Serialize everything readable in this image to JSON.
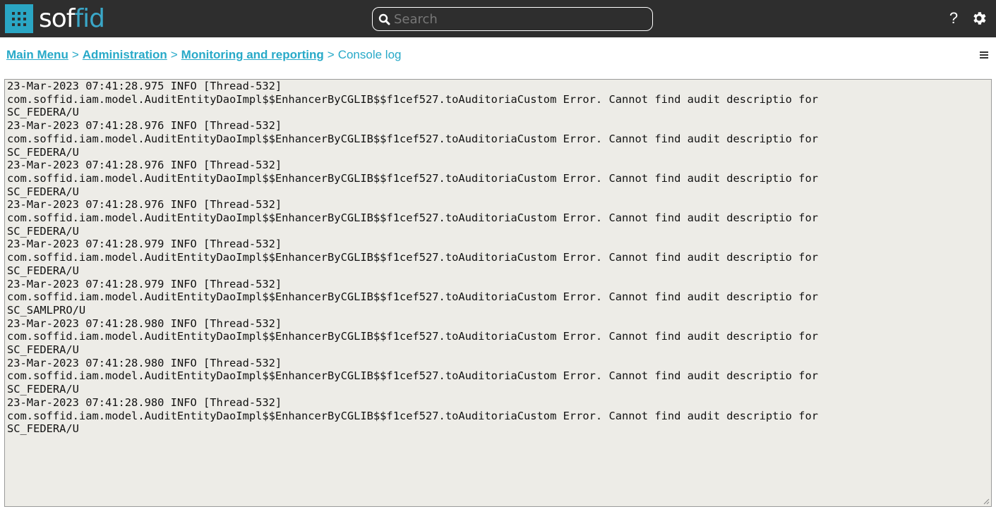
{
  "header": {
    "logo_part1": "sof",
    "logo_part2": "fid",
    "search_placeholder": "Search",
    "help_label": "?"
  },
  "breadcrumb": {
    "items": [
      "Main Menu",
      "Administration",
      "Monitoring and reporting"
    ],
    "separator": ">",
    "current": "Console log"
  },
  "console": {
    "lines": [
      "23-Mar-2023 07:41:28.975 INFO [Thread-532]",
      "com.soffid.iam.model.AuditEntityDaoImpl$$EnhancerByCGLIB$$f1cef527.toAuditoriaCustom Error. Cannot find audit descriptio for",
      "SC_FEDERA/U",
      "23-Mar-2023 07:41:28.976 INFO [Thread-532]",
      "com.soffid.iam.model.AuditEntityDaoImpl$$EnhancerByCGLIB$$f1cef527.toAuditoriaCustom Error. Cannot find audit descriptio for",
      "SC_FEDERA/U",
      "23-Mar-2023 07:41:28.976 INFO [Thread-532]",
      "com.soffid.iam.model.AuditEntityDaoImpl$$EnhancerByCGLIB$$f1cef527.toAuditoriaCustom Error. Cannot find audit descriptio for",
      "SC_FEDERA/U",
      "23-Mar-2023 07:41:28.976 INFO [Thread-532]",
      "com.soffid.iam.model.AuditEntityDaoImpl$$EnhancerByCGLIB$$f1cef527.toAuditoriaCustom Error. Cannot find audit descriptio for",
      "SC_FEDERA/U",
      "23-Mar-2023 07:41:28.979 INFO [Thread-532]",
      "com.soffid.iam.model.AuditEntityDaoImpl$$EnhancerByCGLIB$$f1cef527.toAuditoriaCustom Error. Cannot find audit descriptio for",
      "SC_FEDERA/U",
      "23-Mar-2023 07:41:28.979 INFO [Thread-532]",
      "com.soffid.iam.model.AuditEntityDaoImpl$$EnhancerByCGLIB$$f1cef527.toAuditoriaCustom Error. Cannot find audit descriptio for",
      "SC_SAMLPRO/U",
      "23-Mar-2023 07:41:28.980 INFO [Thread-532]",
      "com.soffid.iam.model.AuditEntityDaoImpl$$EnhancerByCGLIB$$f1cef527.toAuditoriaCustom Error. Cannot find audit descriptio for",
      "SC_FEDERA/U",
      "23-Mar-2023 07:41:28.980 INFO [Thread-532]",
      "com.soffid.iam.model.AuditEntityDaoImpl$$EnhancerByCGLIB$$f1cef527.toAuditoriaCustom Error. Cannot find audit descriptio for",
      "SC_FEDERA/U",
      "23-Mar-2023 07:41:28.980 INFO [Thread-532]",
      "com.soffid.iam.model.AuditEntityDaoImpl$$EnhancerByCGLIB$$f1cef527.toAuditoriaCustom Error. Cannot find audit descriptio for",
      "SC_FEDERA/U"
    ]
  },
  "icons": {
    "apps": "apps-grid-icon",
    "search": "search-icon",
    "settings": "gear-icon",
    "menu": "hamburger-menu-icon"
  },
  "colors": {
    "topbar": "#2e2e2e",
    "accent": "#27a9c8",
    "console_bg": "#edece7"
  }
}
